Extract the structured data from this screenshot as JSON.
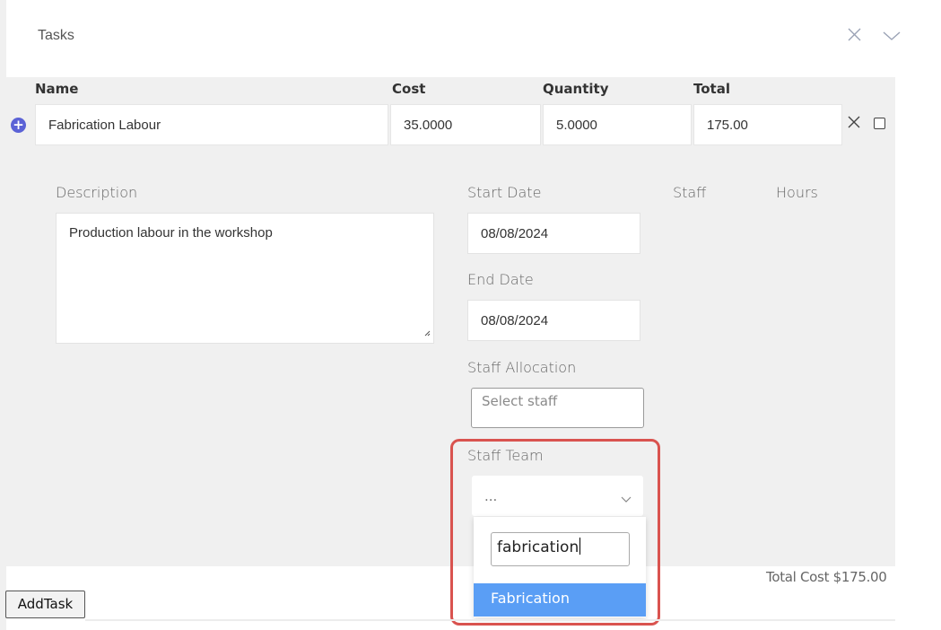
{
  "panel": {
    "title": "Tasks"
  },
  "columns": {
    "name": "Name",
    "cost": "Cost",
    "quantity": "Quantity",
    "total": "Total"
  },
  "task": {
    "name": "Fabrication Labour",
    "cost": "35.0000",
    "quantity": "5.0000",
    "total": "175.00"
  },
  "details": {
    "description_label": "Description",
    "description": "Production labour in the workshop",
    "start_date_label": "Start Date",
    "start_date": "08/08/2024",
    "end_date_label": "End Date",
    "end_date": "08/08/2024",
    "staff_label": "Staff",
    "hours_label": "Hours",
    "staff_allocation_label": "Staff Allocation",
    "staff_allocation_placeholder": "Select staff",
    "staff_team_label": "Staff Team",
    "staff_team_value": "...",
    "staff_team_search": "fabrication",
    "staff_team_options": [
      "Fabrication"
    ]
  },
  "footer": {
    "total_cost": "Total Cost $175.00",
    "add_task": "AddTask"
  },
  "icons": {
    "close": "close-icon",
    "collapse": "chevron-down-icon",
    "add_row": "plus-circle-icon",
    "remove_row": "x-icon",
    "select_row": "checkbox-icon"
  },
  "colors": {
    "highlight": "#d9534f",
    "option_selected": "#5a9ef5",
    "add_icon": "#5b62d6"
  }
}
